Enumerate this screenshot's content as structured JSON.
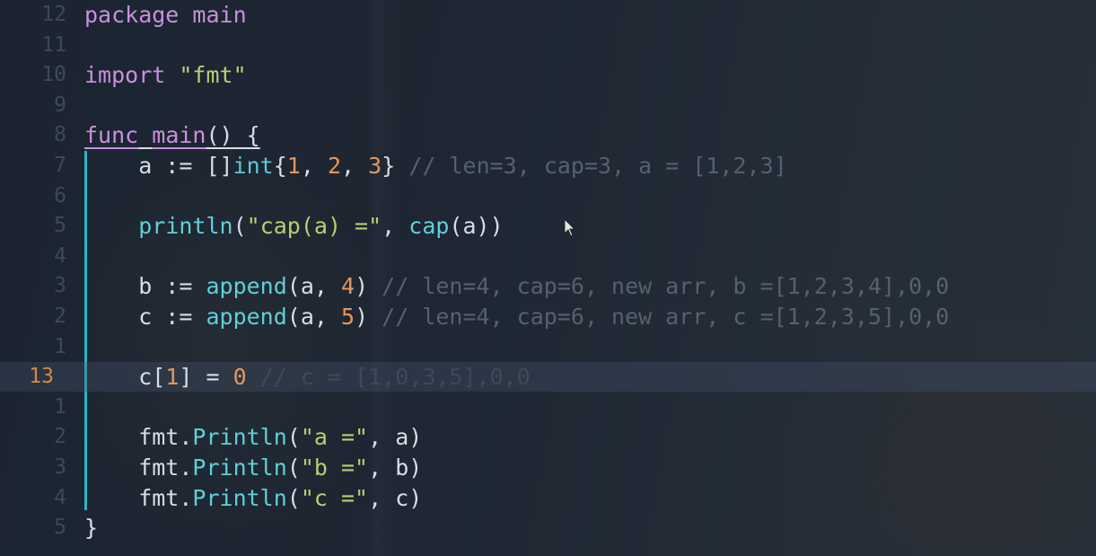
{
  "lines": [
    {
      "num": "12",
      "tokens": [
        {
          "t": "package main",
          "c": "k"
        }
      ]
    },
    {
      "num": "11",
      "tokens": []
    },
    {
      "num": "10",
      "tokens": [
        {
          "t": "import ",
          "c": "k"
        },
        {
          "t": "\"fmt\"",
          "c": "s"
        }
      ]
    },
    {
      "num": "9",
      "tokens": []
    },
    {
      "num": "8",
      "tokens": [
        {
          "t": "func",
          "c": "k u"
        },
        {
          "t": " ",
          "c": "p u"
        },
        {
          "t": "main",
          "c": "k u"
        },
        {
          "t": "() {",
          "c": "p u"
        }
      ]
    },
    {
      "num": "7",
      "tokens": [
        {
          "t": "    a := []",
          "c": "p"
        },
        {
          "t": "int",
          "c": "t"
        },
        {
          "t": "{",
          "c": "p"
        },
        {
          "t": "1",
          "c": "n"
        },
        {
          "t": ", ",
          "c": "p"
        },
        {
          "t": "2",
          "c": "n"
        },
        {
          "t": ", ",
          "c": "p"
        },
        {
          "t": "3",
          "c": "n"
        },
        {
          "t": "} ",
          "c": "p"
        },
        {
          "t": "// len=3, cap=3, a = [1,2,3]",
          "c": "c"
        }
      ]
    },
    {
      "num": "6",
      "tokens": []
    },
    {
      "num": "5",
      "tokens": [
        {
          "t": "    ",
          "c": "p"
        },
        {
          "t": "println",
          "c": "f"
        },
        {
          "t": "(",
          "c": "p"
        },
        {
          "t": "\"cap(a) =\"",
          "c": "s"
        },
        {
          "t": ", ",
          "c": "p"
        },
        {
          "t": "cap",
          "c": "f"
        },
        {
          "t": "(a))",
          "c": "p"
        }
      ]
    },
    {
      "num": "4",
      "tokens": []
    },
    {
      "num": "3",
      "tokens": [
        {
          "t": "    b := ",
          "c": "p"
        },
        {
          "t": "append",
          "c": "f"
        },
        {
          "t": "(a, ",
          "c": "p"
        },
        {
          "t": "4",
          "c": "n"
        },
        {
          "t": ") ",
          "c": "p"
        },
        {
          "t": "// len=4, cap=6, new arr, b =[1,2,3,4],0,0",
          "c": "c"
        }
      ]
    },
    {
      "num": "2",
      "tokens": [
        {
          "t": "    c := ",
          "c": "p"
        },
        {
          "t": "append",
          "c": "f"
        },
        {
          "t": "(a, ",
          "c": "p"
        },
        {
          "t": "5",
          "c": "n"
        },
        {
          "t": ") ",
          "c": "p"
        },
        {
          "t": "// len=4, cap=6, new arr, c =[1,2,3,5],0,0",
          "c": "c"
        }
      ]
    },
    {
      "num": "1",
      "tokens": []
    },
    {
      "num": "13",
      "current": true,
      "tokens": [
        {
          "t": "    c[",
          "c": "p"
        },
        {
          "t": "1",
          "c": "n"
        },
        {
          "t": "] = ",
          "c": "p"
        },
        {
          "t": "0",
          "c": "n"
        },
        {
          "t": " ",
          "c": "p"
        },
        {
          "t": "// c = [1,0,3,5],0,0",
          "c": "c-dim"
        }
      ]
    },
    {
      "num": "1",
      "tokens": []
    },
    {
      "num": "2",
      "tokens": [
        {
          "t": "    fmt.",
          "c": "p"
        },
        {
          "t": "Println",
          "c": "f"
        },
        {
          "t": "(",
          "c": "p"
        },
        {
          "t": "\"a =\"",
          "c": "s"
        },
        {
          "t": ", a)",
          "c": "p"
        }
      ]
    },
    {
      "num": "3",
      "tokens": [
        {
          "t": "    fmt.",
          "c": "p"
        },
        {
          "t": "Println",
          "c": "f"
        },
        {
          "t": "(",
          "c": "p"
        },
        {
          "t": "\"b =\"",
          "c": "s"
        },
        {
          "t": ", b)",
          "c": "p"
        }
      ]
    },
    {
      "num": "4",
      "tokens": [
        {
          "t": "    fmt.",
          "c": "p"
        },
        {
          "t": "Println",
          "c": "f"
        },
        {
          "t": "(",
          "c": "p"
        },
        {
          "t": "\"c =\"",
          "c": "s"
        },
        {
          "t": ", c)",
          "c": "p"
        }
      ]
    },
    {
      "num": "5",
      "tokens": [
        {
          "t": "}",
          "c": "p"
        }
      ]
    }
  ],
  "icons": {
    "cursor": "mouse-pointer-icon"
  },
  "colors": {
    "current_line_number": "#d8883f",
    "indent_guide": "#2ab5c4"
  }
}
